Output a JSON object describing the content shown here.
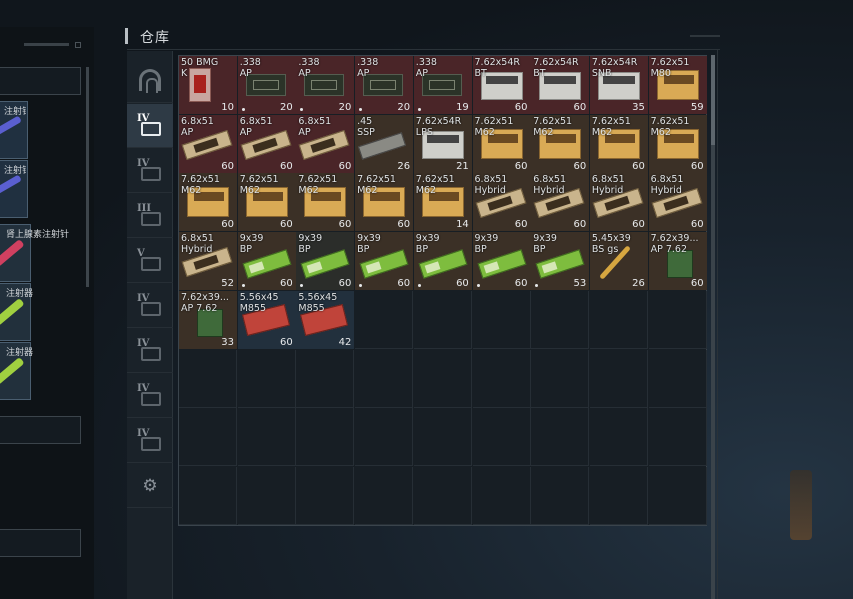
{
  "stash": {
    "title": "仓库"
  },
  "left_panel": {
    "slots": [
      {
        "label": "注射针",
        "color": "#5a5fd0"
      },
      {
        "label": "注射针",
        "color": "#5a5fd0"
      },
      {
        "label": "肾上腺素注射针",
        "color": "#d04060"
      },
      {
        "label": "注射器",
        "color": "#a0d040"
      },
      {
        "label": "注射器",
        "color": "#a0d040"
      }
    ]
  },
  "tabs": [
    {
      "name": "tab-home",
      "roman": "",
      "icon": "arch-icon"
    },
    {
      "name": "tab-stash-iv-a",
      "roman": "IV",
      "icon": "stash-icon",
      "active": true
    },
    {
      "name": "tab-stash-iv-b",
      "roman": "IV",
      "icon": "stash-icon"
    },
    {
      "name": "tab-stash-iii",
      "roman": "III",
      "icon": "stash-icon"
    },
    {
      "name": "tab-stash-v",
      "roman": "V",
      "icon": "stash-icon"
    },
    {
      "name": "tab-stash-iv-c",
      "roman": "IV",
      "icon": "stash-icon"
    },
    {
      "name": "tab-stash-iv-d",
      "roman": "IV",
      "icon": "stash-icon"
    },
    {
      "name": "tab-stash-iv-e",
      "roman": "IV",
      "icon": "stash-icon"
    },
    {
      "name": "tab-stash-iv-f",
      "roman": "IV",
      "icon": "stash-icon"
    },
    {
      "name": "tab-settings",
      "roman": "",
      "icon": "gear-icon"
    }
  ],
  "items": [
    {
      "name": "50 BMG\nK",
      "count": "10",
      "bg": "red",
      "art": "pack",
      "dot": false
    },
    {
      "name": ".338\nAP",
      "count": "20",
      "bg": "red",
      "art": "green",
      "dot": true
    },
    {
      "name": ".338\nAP",
      "count": "20",
      "bg": "red",
      "art": "green",
      "dot": true
    },
    {
      "name": ".338\nAP",
      "count": "20",
      "bg": "red",
      "art": "green",
      "dot": true
    },
    {
      "name": ".338\nAP",
      "count": "19",
      "bg": "red",
      "art": "green",
      "dot": true
    },
    {
      "name": "7.62x54R\nBT",
      "count": "60",
      "bg": "red",
      "art": "white",
      "dot": false
    },
    {
      "name": "7.62x54R\nBT",
      "count": "60",
      "bg": "red",
      "art": "white",
      "dot": false
    },
    {
      "name": "7.62x54R\nSNB",
      "count": "35",
      "bg": "red",
      "art": "white",
      "dot": false
    },
    {
      "name": "7.62x51\nM80",
      "count": "59",
      "bg": "red",
      "art": "tan",
      "dot": false
    },
    {
      "name": "6.8x51\nAP",
      "count": "60",
      "bg": "red",
      "art": "flat",
      "dot": false
    },
    {
      "name": "6.8x51\nAP",
      "count": "60",
      "bg": "red",
      "art": "flat",
      "dot": false
    },
    {
      "name": "6.8x51\nAP",
      "count": "60",
      "bg": "red",
      "art": "flat",
      "dot": false
    },
    {
      "name": ".45\nSSP",
      "count": "26",
      "bg": "brn",
      "art": "tin",
      "dot": false
    },
    {
      "name": "7.62x54R\nLPS",
      "count": "21",
      "bg": "brn",
      "art": "white",
      "dot": false
    },
    {
      "name": "7.62x51\nM62",
      "count": "60",
      "bg": "brn",
      "art": "tan",
      "dot": false
    },
    {
      "name": "7.62x51\nM62",
      "count": "60",
      "bg": "brn",
      "art": "tan",
      "dot": false
    },
    {
      "name": "7.62x51\nM62",
      "count": "60",
      "bg": "brn",
      "art": "tan",
      "dot": false
    },
    {
      "name": "7.62x51\nM62",
      "count": "60",
      "bg": "brn",
      "art": "tan",
      "dot": false
    },
    {
      "name": "7.62x51\nM62",
      "count": "60",
      "bg": "brn",
      "art": "tan",
      "dot": false
    },
    {
      "name": "7.62x51\nM62",
      "count": "60",
      "bg": "brn",
      "art": "tan",
      "dot": false
    },
    {
      "name": "7.62x51\nM62",
      "count": "60",
      "bg": "brn",
      "art": "tan",
      "dot": false
    },
    {
      "name": "7.62x51\nM62",
      "count": "60",
      "bg": "brn",
      "art": "tan",
      "dot": false
    },
    {
      "name": "7.62x51\nM62",
      "count": "14",
      "bg": "brn",
      "art": "tan",
      "dot": false
    },
    {
      "name": "6.8x51\nHybrid",
      "count": "60",
      "bg": "brn",
      "art": "flat",
      "dot": false
    },
    {
      "name": "6.8x51\nHybrid",
      "count": "60",
      "bg": "brn",
      "art": "flat",
      "dot": false
    },
    {
      "name": "6.8x51\nHybrid",
      "count": "60",
      "bg": "brn",
      "art": "flat",
      "dot": false
    },
    {
      "name": "6.8x51\nHybrid",
      "count": "60",
      "bg": "brn",
      "art": "flat",
      "dot": false
    },
    {
      "name": "6.8x51\nHybrid",
      "count": "52",
      "bg": "brn",
      "art": "flat",
      "dot": false
    },
    {
      "name": "9x39\nBP",
      "count": "60",
      "bg": "brn",
      "art": "lime",
      "dot": true
    },
    {
      "name": "9x39\nBP",
      "count": "60",
      "bg": "dark",
      "art": "lime",
      "dot": true
    },
    {
      "name": "9x39\nBP",
      "count": "60",
      "bg": "brn",
      "art": "lime",
      "dot": true
    },
    {
      "name": "9x39\nBP",
      "count": "60",
      "bg": "brn",
      "art": "lime",
      "dot": true
    },
    {
      "name": "9x39\nBP",
      "count": "60",
      "bg": "brn",
      "art": "lime",
      "dot": true
    },
    {
      "name": "9x39\nBP",
      "count": "53",
      "bg": "brn",
      "art": "lime",
      "dot": true
    },
    {
      "name": "5.45x39\nBS gs",
      "count": "26",
      "bg": "brn",
      "art": "round",
      "dot": false
    },
    {
      "name": "7.62x39...\nAP 7.62",
      "count": "60",
      "bg": "brn",
      "art": "can",
      "dot": false
    },
    {
      "name": "7.62x39...\nAP 7.62",
      "count": "33",
      "bg": "brn",
      "art": "can",
      "dot": false
    },
    {
      "name": "5.56x45\nM855",
      "count": "60",
      "bg": "blu",
      "art": "rbox",
      "dot": false
    },
    {
      "name": "5.56x45\nM855",
      "count": "42",
      "bg": "blu",
      "art": "rbox",
      "dot": false
    }
  ]
}
